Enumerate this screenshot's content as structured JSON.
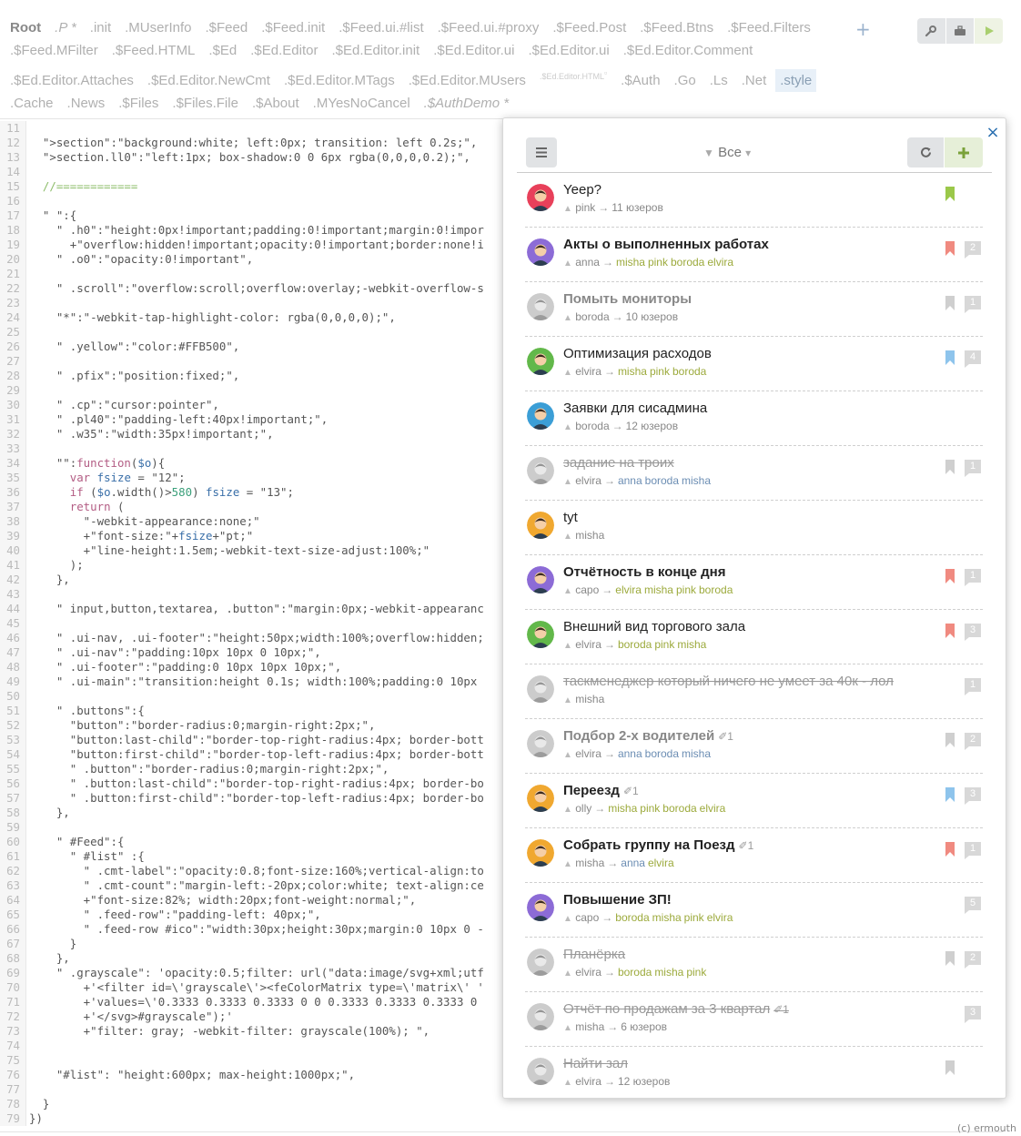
{
  "tabs": [
    {
      "label": "Root",
      "style": "root"
    },
    {
      "label": ".P *",
      "style": "it"
    },
    {
      "label": ".init",
      "style": ""
    },
    {
      "label": ".MUserInfo",
      "style": ""
    },
    {
      "label": ".$Feed",
      "style": ""
    },
    {
      "label": ".$Feed.init",
      "style": ""
    },
    {
      "label": ".$Feed.ui.#list",
      "style": ""
    },
    {
      "label": ".$Feed.ui.#proxy",
      "style": ""
    },
    {
      "label": ".$Feed.Post",
      "style": ""
    },
    {
      "label": ".$Feed.Btns",
      "style": ""
    },
    {
      "label": ".$Feed.Filters",
      "style": ""
    },
    {
      "label": ".$Feed.MFilter",
      "style": ""
    },
    {
      "label": ".$Feed.HTML",
      "style": ""
    },
    {
      "label": ".$Ed",
      "style": ""
    },
    {
      "label": ".$Ed.Editor",
      "style": ""
    },
    {
      "label": ".$Ed.Editor.init",
      "style": ""
    },
    {
      "label": ".$Ed.Editor.ui",
      "style": ""
    },
    {
      "label": ".$Ed.Editor.ui",
      "style": ""
    },
    {
      "label": ".$Ed.Editor.Comment",
      "style": ""
    },
    {
      "label": ".$Ed.Editor.Attaches",
      "style": ""
    },
    {
      "label": ".$Ed.Editor.NewCmt",
      "style": ""
    },
    {
      "label": ".$Ed.Editor.MTags",
      "style": ""
    },
    {
      "label": ".$Ed.Editor.MUsers",
      "style": ""
    },
    {
      "label": ".$Ed.Editor.HTML",
      "style": "trash"
    },
    {
      "label": ".$Auth",
      "style": ""
    },
    {
      "label": ".Go",
      "style": ""
    },
    {
      "label": ".Ls",
      "style": ""
    },
    {
      "label": ".Net",
      "style": ""
    },
    {
      "label": ".style",
      "style": "active"
    },
    {
      "label": ".Cache",
      "style": ""
    },
    {
      "label": ".News",
      "style": ""
    },
    {
      "label": ".$Files",
      "style": ""
    },
    {
      "label": ".$Files.File",
      "style": ""
    },
    {
      "label": ".$About",
      "style": ""
    },
    {
      "label": ".MYesNoCancel",
      "style": ""
    },
    {
      "label": ".$AuthDemo *",
      "style": "it"
    }
  ],
  "toolbar": {
    "plus": "+"
  },
  "code": [
    [
      11,
      ""
    ],
    [
      12,
      "  \">section\":\"background:white; left:0px; transition: left 0.2s;\","
    ],
    [
      13,
      "  \">section.ll0\":\"left:1px; box-shadow:0 0 6px rgba(0,0,0,0.2);\","
    ],
    [
      14,
      ""
    ],
    [
      15,
      "  //============"
    ],
    [
      16,
      ""
    ],
    [
      17,
      "  \" \":{"
    ],
    [
      18,
      "    \" .h0\":\"height:0px!important;padding:0!important;margin:0!impor"
    ],
    [
      19,
      "      +\"overflow:hidden!important;opacity:0!important;border:none!i"
    ],
    [
      20,
      "    \" .o0\":\"opacity:0!important\","
    ],
    [
      21,
      ""
    ],
    [
      22,
      "    \" .scroll\":\"overflow:scroll;overflow:overlay;-webkit-overflow-s"
    ],
    [
      23,
      ""
    ],
    [
      24,
      "    \"*\":\"-webkit-tap-highlight-color: rgba(0,0,0,0);\","
    ],
    [
      25,
      ""
    ],
    [
      26,
      "    \" .yellow\":\"color:#FFB500\","
    ],
    [
      27,
      ""
    ],
    [
      28,
      "    \" .pfix\":\"position:fixed;\","
    ],
    [
      29,
      ""
    ],
    [
      30,
      "    \" .cp\":\"cursor:pointer\","
    ],
    [
      31,
      "    \" .pl40\":\"padding-left:40px!important;\","
    ],
    [
      32,
      "    \" .w35\":\"width:35px!important;\","
    ],
    [
      33,
      ""
    ],
    [
      34,
      "    \"\":function($o){"
    ],
    [
      35,
      "      var fsize = \"12\";"
    ],
    [
      36,
      "      if ($o.width()>580) fsize = \"13\";"
    ],
    [
      37,
      "      return ("
    ],
    [
      38,
      "        \"-webkit-appearance:none;\""
    ],
    [
      39,
      "        +\"font-size:\"+fsize+\"pt;\""
    ],
    [
      40,
      "        +\"line-height:1.5em;-webkit-text-size-adjust:100%;\""
    ],
    [
      41,
      "      );"
    ],
    [
      42,
      "    },"
    ],
    [
      43,
      ""
    ],
    [
      44,
      "    \" input,button,textarea, .button\":\"margin:0px;-webkit-appearanc"
    ],
    [
      45,
      ""
    ],
    [
      46,
      "    \" .ui-nav, .ui-footer\":\"height:50px;width:100%;overflow:hidden;"
    ],
    [
      47,
      "    \" .ui-nav\":\"padding:10px 10px 0 10px;\","
    ],
    [
      48,
      "    \" .ui-footer\":\"padding:0 10px 10px 10px;\","
    ],
    [
      49,
      "    \" .ui-main\":\"transition:height 0.1s; width:100%;padding:0 10px"
    ],
    [
      50,
      ""
    ],
    [
      51,
      "    \" .buttons\":{"
    ],
    [
      52,
      "      \"button\":\"border-radius:0;margin-right:2px;\","
    ],
    [
      53,
      "      \"button:last-child\":\"border-top-right-radius:4px; border-bott"
    ],
    [
      54,
      "      \"button:first-child\":\"border-top-left-radius:4px; border-bott"
    ],
    [
      55,
      "      \" .button\":\"border-radius:0;margin-right:2px;\","
    ],
    [
      56,
      "      \" .button:last-child\":\"border-top-right-radius:4px; border-bo"
    ],
    [
      57,
      "      \" .button:first-child\":\"border-top-left-radius:4px; border-bo"
    ],
    [
      58,
      "    },"
    ],
    [
      59,
      ""
    ],
    [
      60,
      "    \" #Feed\":{"
    ],
    [
      61,
      "      \" #list\" :{"
    ],
    [
      62,
      "        \" .cmt-label\":\"opacity:0.8;font-size:160%;vertical-align:to"
    ],
    [
      63,
      "        \" .cmt-count\":\"margin-left:-20px;color:white; text-align:ce"
    ],
    [
      64,
      "        +\"font-size:82%; width:20px;font-weight:normal;\","
    ],
    [
      65,
      "        \" .feed-row\":\"padding-left: 40px;\","
    ],
    [
      66,
      "        \" .feed-row #ico\":\"width:30px;height:30px;margin:0 10px 0 -"
    ],
    [
      67,
      "      }"
    ],
    [
      68,
      "    },"
    ],
    [
      69,
      "    \" .grayscale\": 'opacity:0.5;filter: url(\"data:image/svg+xml;utf"
    ],
    [
      70,
      "        +'<filter id=\\'grayscale\\'><feColorMatrix type=\\'matrix\\' '"
    ],
    [
      71,
      "        +'values=\\'0.3333 0.3333 0.3333 0 0 0.3333 0.3333 0.3333 0 "
    ],
    [
      72,
      "        +'</svg>#grayscale\");'"
    ],
    [
      73,
      "        +\"filter: gray; -webkit-filter: grayscale(100%); \","
    ],
    [
      74,
      ""
    ],
    [
      75,
      ""
    ],
    [
      76,
      "    \"#list\": \"height:600px; max-height:1000px;\","
    ],
    [
      77,
      ""
    ],
    [
      78,
      "  }"
    ],
    [
      79,
      "})"
    ]
  ],
  "feed": {
    "filter_label": "Все",
    "close": "×",
    "items": [
      {
        "title": "Yeep?",
        "style": "",
        "author": "pink",
        "recipients": [],
        "recipients_text": "11 юзеров",
        "bookmark": "#9bc84a",
        "count": "",
        "clip": "",
        "avatar": "#e8405a",
        "gray": false
      },
      {
        "title": "Акты о выполненных работах",
        "style": "bold",
        "author": "anna",
        "recipients": [
          "misha",
          "pink",
          "boroda",
          "elvira"
        ],
        "recipients_text": "",
        "bookmark": "#f08a80",
        "count": "2",
        "clip": "",
        "avatar": "#8c6bd6",
        "gray": false
      },
      {
        "title": "Помыть мониторы",
        "style": "bold grayt",
        "author": "boroda",
        "recipients": [],
        "recipients_text": "10 юзеров",
        "bookmark": "#cfcfcf",
        "count": "1",
        "clip": "",
        "avatar": "#9a9a9a",
        "gray": true
      },
      {
        "title": "Оптимизация расходов",
        "style": "",
        "author": "elvira",
        "recipients": [
          "misha",
          "pink",
          "boroda"
        ],
        "recipients_text": "",
        "bookmark": "#8ec4ec",
        "count": "4",
        "clip": "",
        "avatar": "#62b84a",
        "gray": false
      },
      {
        "title": "Заявки для сисадмина",
        "style": "",
        "author": "boroda",
        "recipients": [],
        "recipients_text": "12 юзеров",
        "bookmark": "",
        "count": "",
        "clip": "",
        "avatar": "#3b9ed6",
        "gray": false
      },
      {
        "title": "задание на троих",
        "style": "strike",
        "author": "elvira",
        "recipients": [
          "anna",
          "boroda",
          "misha"
        ],
        "recipients_text": "",
        "bookmark": "#cfcfcf",
        "count": "1",
        "clip": "",
        "avatar": "#9a9a9a",
        "gray": true
      },
      {
        "title": "tyt",
        "style": "",
        "author": "misha",
        "recipients": [],
        "recipients_text": "",
        "bookmark": "",
        "count": "",
        "clip": "",
        "avatar": "#f0a830",
        "gray": false
      },
      {
        "title": "Отчётность в конце дня",
        "style": "bold",
        "author": "capo",
        "recipients": [
          "elvira",
          "misha",
          "pink",
          "boroda"
        ],
        "recipients_text": "",
        "bookmark": "#f08a80",
        "count": "1",
        "clip": "",
        "avatar": "#8c6bd6",
        "gray": false
      },
      {
        "title": "Внешний вид торгового зала",
        "style": "",
        "author": "elvira",
        "recipients": [
          "boroda",
          "pink",
          "misha"
        ],
        "recipients_text": "",
        "bookmark": "#f08a80",
        "count": "3",
        "clip": "",
        "avatar": "#62b84a",
        "gray": false
      },
      {
        "title": "таскменеджер который ничего не умеет за 40к - лол",
        "style": "strike",
        "author": "misha",
        "recipients": [],
        "recipients_text": "",
        "bookmark": "",
        "count": "1",
        "clip": "",
        "avatar": "#9a9a9a",
        "gray": true
      },
      {
        "title": "Подбор 2-х водителей",
        "style": "bold grayt",
        "author": "elvira",
        "recipients": [
          "anna",
          "boroda",
          "misha"
        ],
        "recipients_text": "",
        "bookmark": "#cfcfcf",
        "count": "2",
        "clip": "1",
        "avatar": "#9a9a9a",
        "gray": true
      },
      {
        "title": "Переезд",
        "style": "bold",
        "author": "olly",
        "recipients": [
          "misha",
          "pink",
          "boroda",
          "elvira"
        ],
        "recipients_text": "",
        "bookmark": "#8ec4ec",
        "count": "3",
        "clip": "1",
        "avatar": "#f0a830",
        "gray": false
      },
      {
        "title": "Собрать группу на Поезд",
        "style": "bold",
        "author": "misha",
        "recipients": [
          "anna",
          "elvira"
        ],
        "recipients_text": "",
        "bookmark": "#f08a80",
        "count": "1",
        "clip": "1",
        "avatar": "#f0a830",
        "gray": false
      },
      {
        "title": "Повышение ЗП!",
        "style": "bold",
        "author": "capo",
        "recipients": [
          "boroda",
          "misha",
          "pink",
          "elvira"
        ],
        "recipients_text": "",
        "bookmark": "",
        "count": "5",
        "clip": "",
        "avatar": "#8c6bd6",
        "gray": false
      },
      {
        "title": "Планёрка",
        "style": "strike",
        "author": "elvira",
        "recipients": [
          "boroda",
          "misha",
          "pink"
        ],
        "recipients_text": "",
        "bookmark": "#cfcfcf",
        "count": "2",
        "clip": "",
        "avatar": "#9a9a9a",
        "gray": true
      },
      {
        "title": "Отчёт по продажам за 3 квартал",
        "style": "strike",
        "author": "misha",
        "recipients": [],
        "recipients_text": "6 юзеров",
        "bookmark": "",
        "count": "3",
        "clip": "1",
        "avatar": "#9a9a9a",
        "gray": true
      },
      {
        "title": "Найти зал",
        "style": "strike",
        "author": "elvira",
        "recipients": [],
        "recipients_text": "12 юзеров",
        "bookmark": "#cfcfcf",
        "count": "",
        "clip": "",
        "avatar": "#9a9a9a",
        "gray": true
      }
    ]
  },
  "footer": {
    "copyright": "(c) ermouth"
  }
}
